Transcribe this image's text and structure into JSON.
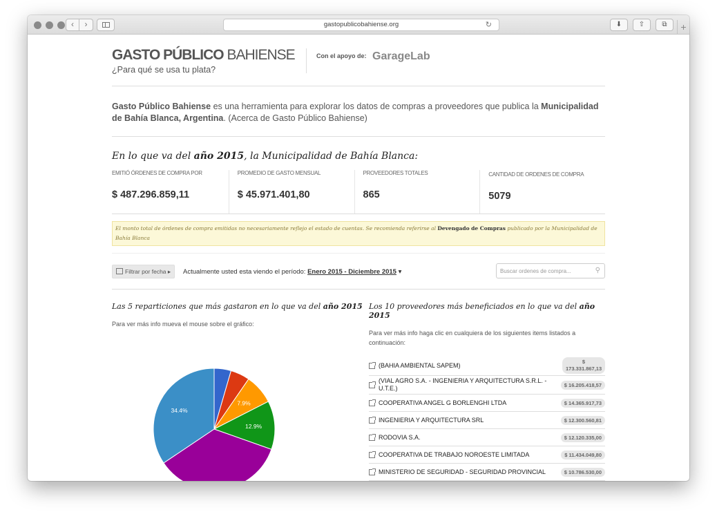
{
  "browser": {
    "url": "gastopublicobahiense.org"
  },
  "header": {
    "title_bold": "GASTO PÚBLICO",
    "title_light": " BAHIENSE",
    "subtitle": "¿Para qué se usa tu plata?",
    "support_label": "Con el apoyo de:",
    "support_brand": "GarageLab"
  },
  "intro": {
    "name": "Gasto Público Bahiense",
    "text1": " es una herramienta para explorar los datos de compras a proveedores que publica la ",
    "entity": "Municipalidad de Bahía Blanca, Argentina",
    "text2": ". (Acerca de Gasto Público Bahiense)"
  },
  "stats": {
    "title_pre": "En lo que va del ",
    "title_year": "año 2015",
    "title_post": ", la Municipalidad de Bahía Blanca:",
    "items": [
      {
        "label": "Emitió órdenes de compra por",
        "value": "$ 487.296.859,11"
      },
      {
        "label": "Promedio de gasto mensual",
        "value": "$ 45.971.401,80"
      },
      {
        "label": "Proveedores totales",
        "value": "865"
      },
      {
        "label": "Cantidad de ordenes de compra",
        "value": "5079"
      }
    ]
  },
  "notice": {
    "text1": "El monto total de órdenes de compra emitidas no necesariamente reflejo el estado de cuentas. Se recomienda referirse al ",
    "link": "Devengado de Compras",
    "text2": " publicado por la Municipalidad de Bahía Blanca"
  },
  "filter": {
    "button": "Filtrar por fecha",
    "period_label": "Actualmente usted esta viendo el período:",
    "period_from": "Enero 2015",
    "period_sep": " - ",
    "period_to": "Diciembre 2015",
    "search_placeholder": "Buscar ordenes de compra..."
  },
  "left": {
    "title_pre": "Las 5 reparticiones que más gastaron en lo que va del ",
    "title_year": "año 2015",
    "hint": "Para ver más info mueva el mouse sobre el gráfico:"
  },
  "right": {
    "title_pre": "Los 10 proveedores más beneficiados en lo que va del ",
    "title_year": "año 2015",
    "hint": "Para ver más info haga clic en cualquiera de los siguientes items listados a continuación:",
    "providers": [
      {
        "name": "(BAHIA AMBIENTAL SAPEM)",
        "amount": "$ 173.331.867,13"
      },
      {
        "name": "(VIAL AGRO S.A. - INGENIERIA Y ARQUITECTURA S.R.L. - U.T.E.)",
        "amount": "$ 16.205.418,57"
      },
      {
        "name": "COOPERATIVA ANGEL G BORLENGHI LTDA",
        "amount": "$ 14.365.917,73"
      },
      {
        "name": "INGENIERIA Y ARQUITECTURA SRL",
        "amount": "$ 12.300.560,81"
      },
      {
        "name": "RODOVIA S.A.",
        "amount": "$ 12.120.335,00"
      },
      {
        "name": "COOPERATIVA DE TRABAJO NOROESTE LIMITADA",
        "amount": "$ 11.434.049,80"
      },
      {
        "name": "MINISTERIO DE SEGURIDAD - SEGURIDAD PROVINCIAL",
        "amount": "$ 10.786.530,00"
      }
    ]
  },
  "chart_data": {
    "type": "pie",
    "slices": [
      {
        "value": 4.5,
        "color": "#3366cc",
        "label": ""
      },
      {
        "value": 5.1,
        "color": "#dc3912",
        "label": ""
      },
      {
        "value": 7.9,
        "color": "#ff9900",
        "label": "7.9%"
      },
      {
        "value": 12.9,
        "color": "#109618",
        "label": "12.9%"
      },
      {
        "value": 35.2,
        "color": "#990099",
        "label": ""
      },
      {
        "value": 34.4,
        "color": "#3b8fc7",
        "label": "34.4%"
      }
    ]
  }
}
